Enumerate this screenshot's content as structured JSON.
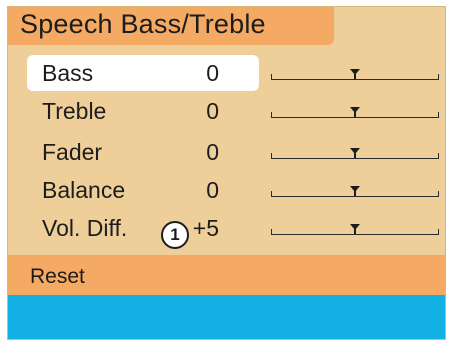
{
  "title": "Speech Bass/Treble",
  "rows": [
    {
      "label": "Bass",
      "value": "0",
      "level": 0.5,
      "selected": true
    },
    {
      "label": "Treble",
      "value": "0",
      "level": 0.5,
      "selected": false
    },
    {
      "label": "Fader",
      "value": "0",
      "level": 0.5,
      "selected": false
    },
    {
      "label": "Balance",
      "value": "0",
      "level": 0.5,
      "selected": false
    },
    {
      "label": "Vol. Diff.",
      "value": "+5",
      "level": 0.5,
      "selected": false
    }
  ],
  "callout_number": "1",
  "reset_label": "Reset",
  "colors": {
    "background": "#efcf99",
    "header_accent": "#f4aa62",
    "selection": "#ffffff",
    "bottom_bar": "#12b0e3"
  }
}
